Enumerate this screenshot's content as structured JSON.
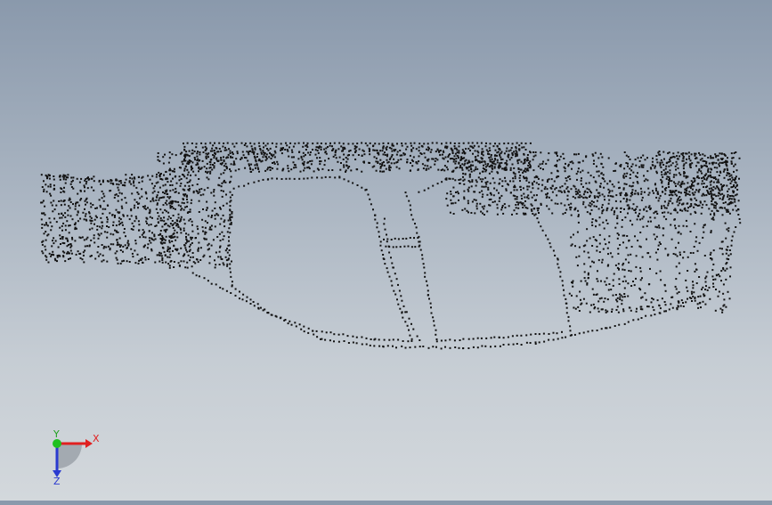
{
  "viewport": {
    "background_top": "#8a99ac",
    "background_bottom": "#d3d8dc",
    "model_point_color": "#111111",
    "model_name": ""
  },
  "triad": {
    "x_label": "X",
    "y_label": "Y",
    "z_label": "Z",
    "x_color": "#e02020",
    "y_color": "#20c020",
    "z_color": "#2a3ad0",
    "icons": [
      "axis-triad-icon"
    ]
  }
}
